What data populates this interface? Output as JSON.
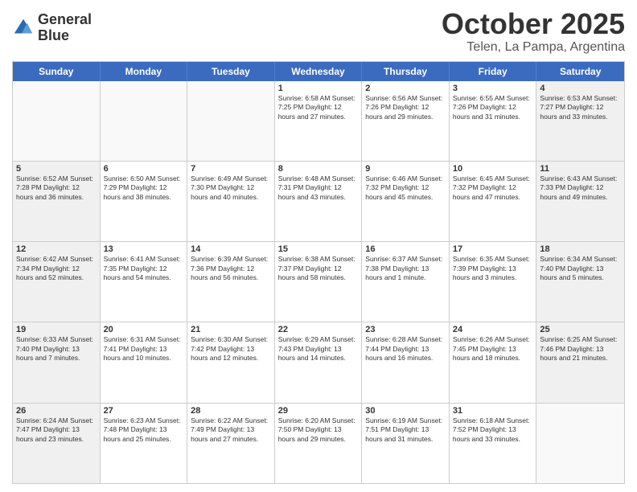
{
  "header": {
    "logo_line1": "General",
    "logo_line2": "Blue",
    "month": "October 2025",
    "location": "Telen, La Pampa, Argentina"
  },
  "weekdays": [
    "Sunday",
    "Monday",
    "Tuesday",
    "Wednesday",
    "Thursday",
    "Friday",
    "Saturday"
  ],
  "rows": [
    [
      {
        "day": "",
        "text": "",
        "empty": true
      },
      {
        "day": "",
        "text": "",
        "empty": true
      },
      {
        "day": "",
        "text": "",
        "empty": true
      },
      {
        "day": "1",
        "text": "Sunrise: 6:58 AM\nSunset: 7:25 PM\nDaylight: 12 hours\nand 27 minutes.",
        "empty": false,
        "shaded": false
      },
      {
        "day": "2",
        "text": "Sunrise: 6:56 AM\nSunset: 7:26 PM\nDaylight: 12 hours\nand 29 minutes.",
        "empty": false,
        "shaded": false
      },
      {
        "day": "3",
        "text": "Sunrise: 6:55 AM\nSunset: 7:26 PM\nDaylight: 12 hours\nand 31 minutes.",
        "empty": false,
        "shaded": false
      },
      {
        "day": "4",
        "text": "Sunrise: 6:53 AM\nSunset: 7:27 PM\nDaylight: 12 hours\nand 33 minutes.",
        "empty": false,
        "shaded": true
      }
    ],
    [
      {
        "day": "5",
        "text": "Sunrise: 6:52 AM\nSunset: 7:28 PM\nDaylight: 12 hours\nand 36 minutes.",
        "empty": false,
        "shaded": true
      },
      {
        "day": "6",
        "text": "Sunrise: 6:50 AM\nSunset: 7:29 PM\nDaylight: 12 hours\nand 38 minutes.",
        "empty": false,
        "shaded": false
      },
      {
        "day": "7",
        "text": "Sunrise: 6:49 AM\nSunset: 7:30 PM\nDaylight: 12 hours\nand 40 minutes.",
        "empty": false,
        "shaded": false
      },
      {
        "day": "8",
        "text": "Sunrise: 6:48 AM\nSunset: 7:31 PM\nDaylight: 12 hours\nand 43 minutes.",
        "empty": false,
        "shaded": false
      },
      {
        "day": "9",
        "text": "Sunrise: 6:46 AM\nSunset: 7:32 PM\nDaylight: 12 hours\nand 45 minutes.",
        "empty": false,
        "shaded": false
      },
      {
        "day": "10",
        "text": "Sunrise: 6:45 AM\nSunset: 7:32 PM\nDaylight: 12 hours\nand 47 minutes.",
        "empty": false,
        "shaded": false
      },
      {
        "day": "11",
        "text": "Sunrise: 6:43 AM\nSunset: 7:33 PM\nDaylight: 12 hours\nand 49 minutes.",
        "empty": false,
        "shaded": true
      }
    ],
    [
      {
        "day": "12",
        "text": "Sunrise: 6:42 AM\nSunset: 7:34 PM\nDaylight: 12 hours\nand 52 minutes.",
        "empty": false,
        "shaded": true
      },
      {
        "day": "13",
        "text": "Sunrise: 6:41 AM\nSunset: 7:35 PM\nDaylight: 12 hours\nand 54 minutes.",
        "empty": false,
        "shaded": false
      },
      {
        "day": "14",
        "text": "Sunrise: 6:39 AM\nSunset: 7:36 PM\nDaylight: 12 hours\nand 56 minutes.",
        "empty": false,
        "shaded": false
      },
      {
        "day": "15",
        "text": "Sunrise: 6:38 AM\nSunset: 7:37 PM\nDaylight: 12 hours\nand 58 minutes.",
        "empty": false,
        "shaded": false
      },
      {
        "day": "16",
        "text": "Sunrise: 6:37 AM\nSunset: 7:38 PM\nDaylight: 13 hours\nand 1 minute.",
        "empty": false,
        "shaded": false
      },
      {
        "day": "17",
        "text": "Sunrise: 6:35 AM\nSunset: 7:39 PM\nDaylight: 13 hours\nand 3 minutes.",
        "empty": false,
        "shaded": false
      },
      {
        "day": "18",
        "text": "Sunrise: 6:34 AM\nSunset: 7:40 PM\nDaylight: 13 hours\nand 5 minutes.",
        "empty": false,
        "shaded": true
      }
    ],
    [
      {
        "day": "19",
        "text": "Sunrise: 6:33 AM\nSunset: 7:40 PM\nDaylight: 13 hours\nand 7 minutes.",
        "empty": false,
        "shaded": true
      },
      {
        "day": "20",
        "text": "Sunrise: 6:31 AM\nSunset: 7:41 PM\nDaylight: 13 hours\nand 10 minutes.",
        "empty": false,
        "shaded": false
      },
      {
        "day": "21",
        "text": "Sunrise: 6:30 AM\nSunset: 7:42 PM\nDaylight: 13 hours\nand 12 minutes.",
        "empty": false,
        "shaded": false
      },
      {
        "day": "22",
        "text": "Sunrise: 6:29 AM\nSunset: 7:43 PM\nDaylight: 13 hours\nand 14 minutes.",
        "empty": false,
        "shaded": false
      },
      {
        "day": "23",
        "text": "Sunrise: 6:28 AM\nSunset: 7:44 PM\nDaylight: 13 hours\nand 16 minutes.",
        "empty": false,
        "shaded": false
      },
      {
        "day": "24",
        "text": "Sunrise: 6:26 AM\nSunset: 7:45 PM\nDaylight: 13 hours\nand 18 minutes.",
        "empty": false,
        "shaded": false
      },
      {
        "day": "25",
        "text": "Sunrise: 6:25 AM\nSunset: 7:46 PM\nDaylight: 13 hours\nand 21 minutes.",
        "empty": false,
        "shaded": true
      }
    ],
    [
      {
        "day": "26",
        "text": "Sunrise: 6:24 AM\nSunset: 7:47 PM\nDaylight: 13 hours\nand 23 minutes.",
        "empty": false,
        "shaded": true
      },
      {
        "day": "27",
        "text": "Sunrise: 6:23 AM\nSunset: 7:48 PM\nDaylight: 13 hours\nand 25 minutes.",
        "empty": false,
        "shaded": false
      },
      {
        "day": "28",
        "text": "Sunrise: 6:22 AM\nSunset: 7:49 PM\nDaylight: 13 hours\nand 27 minutes.",
        "empty": false,
        "shaded": false
      },
      {
        "day": "29",
        "text": "Sunrise: 6:20 AM\nSunset: 7:50 PM\nDaylight: 13 hours\nand 29 minutes.",
        "empty": false,
        "shaded": false
      },
      {
        "day": "30",
        "text": "Sunrise: 6:19 AM\nSunset: 7:51 PM\nDaylight: 13 hours\nand 31 minutes.",
        "empty": false,
        "shaded": false
      },
      {
        "day": "31",
        "text": "Sunrise: 6:18 AM\nSunset: 7:52 PM\nDaylight: 13 hours\nand 33 minutes.",
        "empty": false,
        "shaded": false
      },
      {
        "day": "",
        "text": "",
        "empty": true,
        "shaded": true
      }
    ]
  ]
}
